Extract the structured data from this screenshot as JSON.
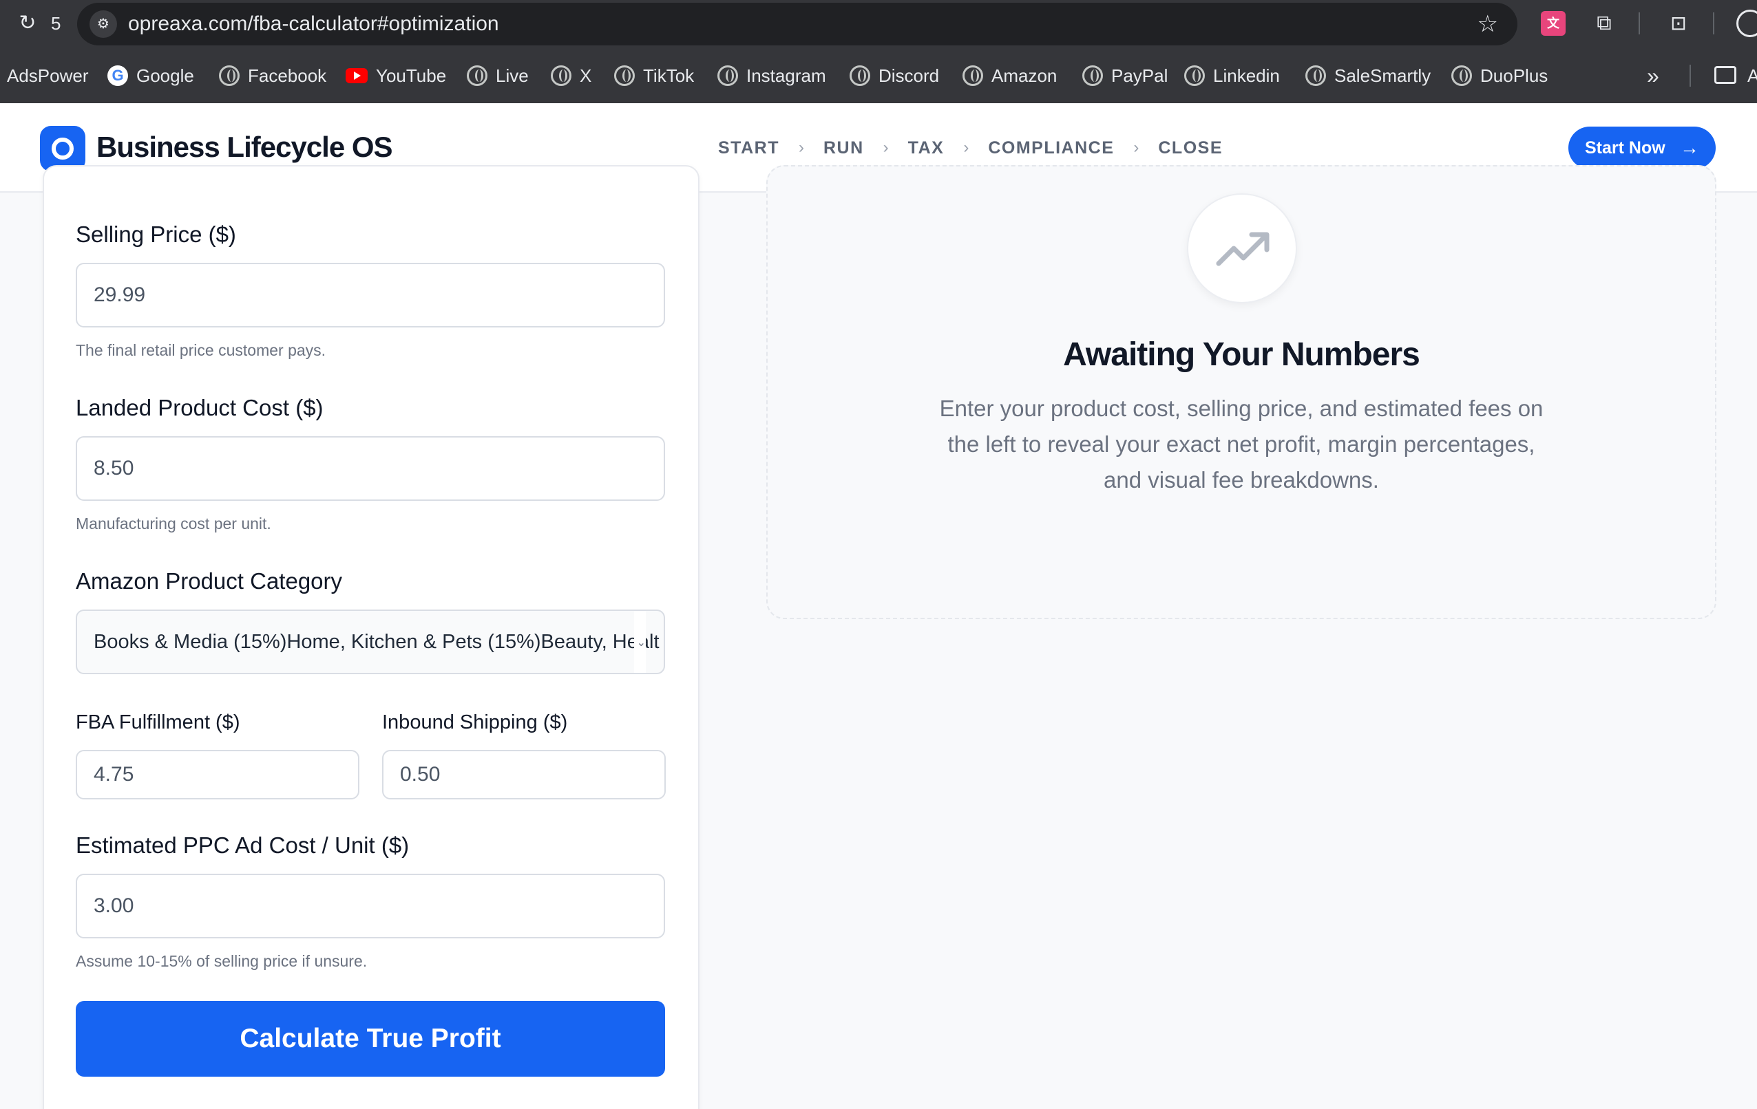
{
  "browser": {
    "tab_count": "5",
    "url": "opreaxa.com/fba-calculator#optimization",
    "bookmarks": [
      "AdsPower",
      "Google",
      "Facebook",
      "YouTube",
      "Live",
      "X",
      "TikTok",
      "Instagram",
      "Discord",
      "Amazon",
      "PayPal",
      "Linkedin",
      "SaleSmartly",
      "DuoPlus"
    ],
    "bookmarks_overflow": "»",
    "folder_label": "A"
  },
  "header": {
    "brand": "Business Lifecycle OS",
    "steps": [
      "START",
      "RUN",
      "TAX",
      "COMPLIANCE",
      "CLOSE"
    ],
    "cta_label": "Start Now",
    "accent_color": "#1764f2"
  },
  "form": {
    "selling_price": {
      "label": "Selling Price ($)",
      "value": "29.99",
      "hint": "The final retail price customer pays."
    },
    "landed_cost": {
      "label": "Landed Product Cost ($)",
      "value": "8.50",
      "hint": "Manufacturing cost per unit."
    },
    "category": {
      "label": "Amazon Product Category",
      "value": "Books & Media (15%)Home, Kitchen & Pets (15%)Beauty, Healt"
    },
    "fba_fulfillment": {
      "label": "FBA Fulfillment ($)",
      "value": "4.75"
    },
    "inbound_shipping": {
      "label": "Inbound Shipping ($)",
      "value": "0.50"
    },
    "ppc_cost": {
      "label": "Estimated PPC Ad Cost / Unit ($)",
      "value": "3.00",
      "hint": "Assume 10-15% of selling price if unsure."
    },
    "submit_label": "Calculate True Profit"
  },
  "result": {
    "icon": "trending-up-icon",
    "title": "Awaiting Your Numbers",
    "description": "Enter your product cost, selling price, and estimated fees on the left to reveal your exact net profit, margin percentages, and visual fee breakdowns."
  }
}
